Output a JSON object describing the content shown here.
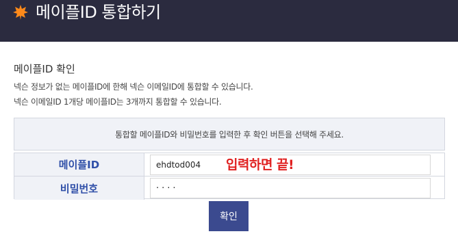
{
  "header": {
    "logo_icon": "maple-leaf-icon",
    "title": "메이플ID 통합하기",
    "background": "#2b2b3f",
    "logo_color": "#ff8a1a"
  },
  "section": {
    "title": "메이플ID 확인",
    "description_line1": "넥슨 정보가 없는 메이플ID에 한해 넥슨 이메일ID에 통합할 수 있습니다.",
    "description_line2": "넥슨 이메일ID 1개당 메이플ID는 3개까지 통합할 수 있습니다."
  },
  "info_box": {
    "text": "통합할 메이플ID와 비밀번호를 입력한 후 확인 버튼을 선택해 주세요."
  },
  "form": {
    "id_label": "메이플ID",
    "id_value": "ehdtod004",
    "password_label": "비밀번호",
    "password_value": "····"
  },
  "annotation": {
    "text": "입력하면 끝!",
    "color": "#e02020"
  },
  "button": {
    "confirm_label": "확인",
    "color": "#3b4a8f"
  }
}
